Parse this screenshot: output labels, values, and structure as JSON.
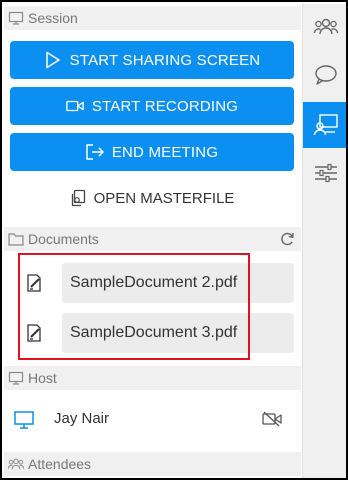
{
  "session": {
    "header": "Session",
    "start_sharing": "START SHARING SCREEN",
    "start_recording": "START RECORDING",
    "end_meeting": "END MEETING",
    "open_masterfile": "OPEN MASTERFILE"
  },
  "documents": {
    "header": "Documents",
    "items": [
      {
        "name": "SampleDocument 2.pdf"
      },
      {
        "name": "SampleDocument 3.pdf"
      }
    ]
  },
  "host": {
    "header": "Host",
    "name": "Jay Nair"
  },
  "attendees": {
    "header": "Attendees"
  },
  "sidebar": {
    "tabs": [
      {
        "icon": "people-icon"
      },
      {
        "icon": "chat-bubble-icon"
      },
      {
        "icon": "presenter-icon",
        "active": true
      },
      {
        "icon": "sliders-icon"
      }
    ]
  },
  "colors": {
    "accent": "#0b8ff0",
    "highlight": "#e0121e",
    "header_bg": "#f0f0f0"
  }
}
